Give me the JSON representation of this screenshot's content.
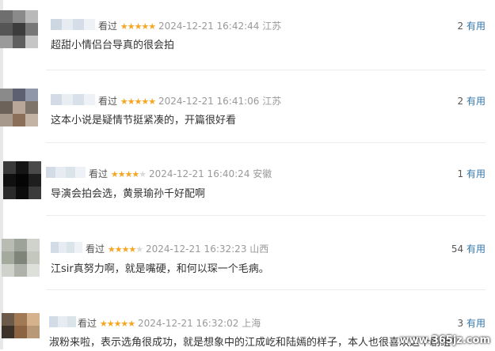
{
  "comments": [
    {
      "watched": "看过",
      "stars": "★★★★★",
      "stars_off": "",
      "time": "2024-12-21 16:42:44",
      "location": "江苏",
      "votes": "2",
      "useful": "有用",
      "text": "超甜小情侣台导真的很会拍"
    },
    {
      "watched": "看过",
      "stars": "★★★★★",
      "stars_off": "",
      "time": "2024-12-21 16:41:06",
      "location": "江苏",
      "votes": "2",
      "useful": "有用",
      "text": "这本小说是疑情节挺紧凑的，开篇很好看"
    },
    {
      "watched": "看过",
      "stars": "★★★★",
      "stars_off": "★",
      "time": "2024-12-21 16:40:24",
      "location": "安徽",
      "votes": "1",
      "useful": "有用",
      "text": "导演会拍会选，黄景瑜孙千好配啊"
    },
    {
      "watched": "看过",
      "stars": "★★★★",
      "stars_off": "★",
      "time": "2024-12-21 16:32:23",
      "location": "山西",
      "votes": "54",
      "useful": "有用",
      "text": "江sir真努力啊，就是嘴硬，和何以琛一个毛病。"
    },
    {
      "watched": "看过",
      "stars": "★★★★★",
      "stars_off": "",
      "time": "2024-12-21 16:32:02",
      "location": "上海",
      "votes": "3",
      "useful": "有用",
      "text": "淑粉来啦，表示选角很成功，就是想象中的江成屹和陆嫣的样子，本人也很喜欢这个剧组！"
    }
  ],
  "watermark": "www.365jz.com",
  "colors": {
    "star_on": "#f5a623",
    "star_off": "#d9d9d9",
    "useful_link": "#3377aa",
    "divider": "#ececec"
  }
}
